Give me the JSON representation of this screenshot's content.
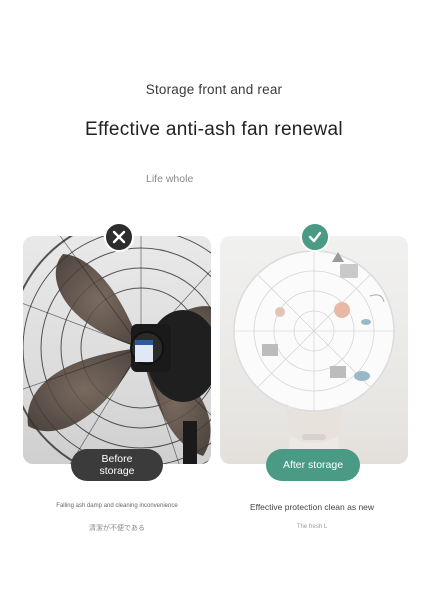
{
  "header": {
    "subtitle": "Storage front and rear",
    "title": "Effective anti-ash fan renewal",
    "tagline": "Life whole"
  },
  "before": {
    "label": "Before storage",
    "caption": "Falling ash damp and cleaning inconvenience",
    "caption_jp": "清潔が不便である",
    "badge_icon": "cross-icon",
    "badge_color": "#2d2d2d"
  },
  "after": {
    "label": "After storage",
    "caption": "Effective protection clean as new",
    "caption_small": "The fresh L",
    "badge_icon": "check-icon",
    "badge_color": "#4a9a86"
  },
  "colors": {
    "accent_green": "#4a9a86",
    "dark_pill": "#3b3b3b"
  }
}
